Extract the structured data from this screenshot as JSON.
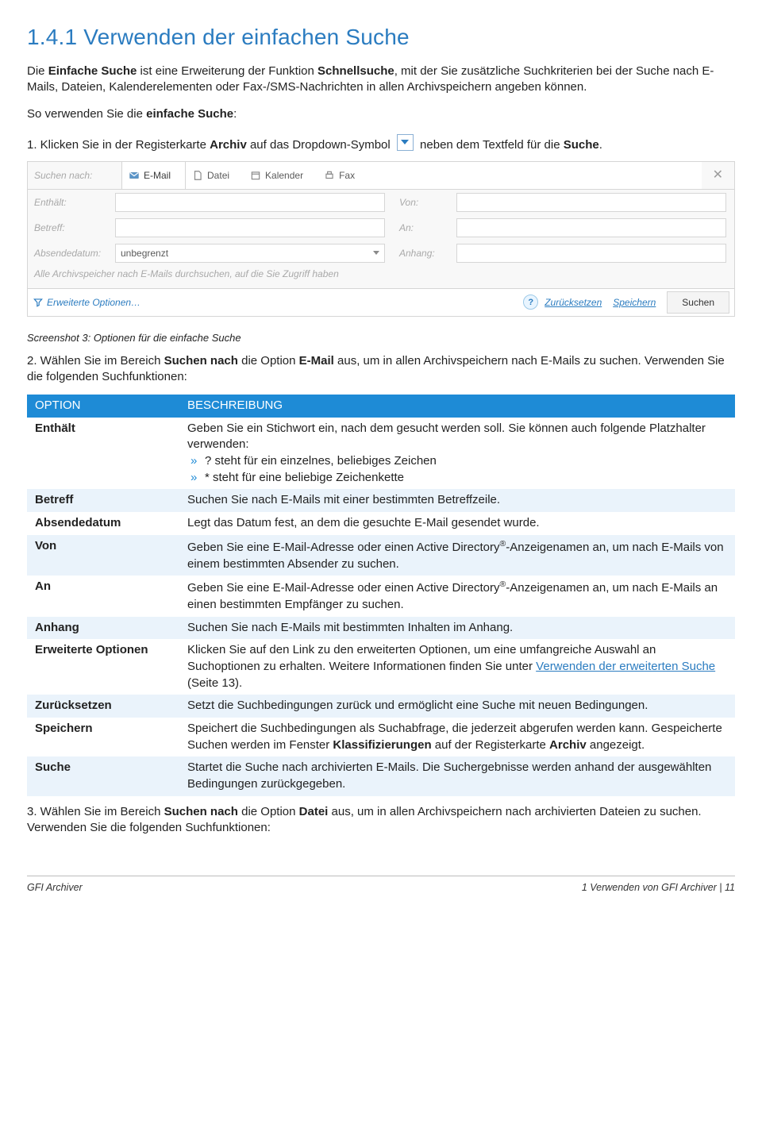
{
  "sectionTitle": "1.4.1 Verwenden der einfachen Suche",
  "intro": {
    "p1_a": "Die ",
    "p1_b": "Einfache Suche",
    "p1_c": " ist eine Erweiterung der Funktion ",
    "p1_d": "Schnellsuche",
    "p1_e": ", mit der Sie zusätzliche Suchkriterien bei der Suche nach E-Mails, Dateien, Kalenderelementen oder Fax-/SMS-Nachrichten in allen Archivspeichern angeben können.",
    "p2_a": "So verwenden Sie die ",
    "p2_b": "einfache Suche",
    "p2_c": ":"
  },
  "step1": {
    "a": "1. Klicken Sie in der Registerkarte ",
    "b": "Archiv",
    "c": " auf das Dropdown-Symbol ",
    "d": " neben dem Textfeld für die ",
    "e": "Suche",
    "f": "."
  },
  "ui": {
    "searchFor": "Suchen nach:",
    "tabs": {
      "email": "E-Mail",
      "file": "Datei",
      "calendar": "Kalender",
      "fax": "Fax"
    },
    "fields": {
      "containsLabel": "Enthält:",
      "fromLabel": "Von:",
      "subjectLabel": "Betreff:",
      "toLabel": "An:",
      "sentDateLabel": "Absendedatum:",
      "sentDateValue": "unbegrenzt",
      "attachmentLabel": "Anhang:"
    },
    "note": "Alle Archivspeicher nach E-Mails durchsuchen, auf die Sie Zugriff haben",
    "advanced": "Erweiterte Optionen…",
    "reset": "Zurücksetzen",
    "save": "Speichern",
    "searchBtn": "Suchen"
  },
  "caption": "Screenshot 3: Optionen für die einfache Suche",
  "step2": {
    "a": "2. Wählen Sie im Bereich ",
    "b": "Suchen nach",
    "c": " die Option ",
    "d": "E-Mail",
    "e": " aus, um in allen Archivspeichern nach E-Mails zu suchen. Verwenden Sie die folgenden Suchfunktionen:"
  },
  "table": {
    "headers": {
      "option": "OPTION",
      "desc": "BESCHREIBUNG"
    },
    "rows": [
      {
        "opt": "Enthält",
        "desc_a": "Geben Sie ein Stichwort ein, nach dem gesucht werden soll. Sie können auch folgende Platzhalter verwenden:",
        "sub1": "? steht für ein einzelnes, beliebiges Zeichen",
        "sub2": "* steht für eine beliebige Zeichenkette"
      },
      {
        "opt": "Betreff",
        "desc": "Suchen Sie nach E-Mails mit einer bestimmten Betreffzeile."
      },
      {
        "opt": "Absendedatum",
        "desc": "Legt das Datum fest, an dem die gesuchte E-Mail gesendet wurde."
      },
      {
        "opt": "Von",
        "desc_a": "Geben Sie eine E-Mail-Adresse oder einen Active Directory",
        "desc_b": "-Anzeigenamen an, um nach E-Mails von einem bestimmten Absender zu suchen."
      },
      {
        "opt": "An",
        "desc_a": "Geben Sie eine E-Mail-Adresse oder einen Active Directory",
        "desc_b": "-Anzeigenamen an, um nach E-Mails an einen bestimmten Empfänger zu suchen."
      },
      {
        "opt": "Anhang",
        "desc": "Suchen Sie nach E-Mails mit bestimmten Inhalten im Anhang."
      },
      {
        "opt": "Erweiterte Optionen",
        "desc_a": "Klicken Sie auf den Link zu den erweiterten Optionen, um eine umfangreiche Auswahl an Suchoptionen zu erhalten. Weitere Informationen finden Sie unter ",
        "link": "Verwenden der erweiterten Suche",
        "desc_b": " (Seite 13)."
      },
      {
        "opt": "Zurücksetzen",
        "desc": "Setzt die Suchbedingungen zurück und ermöglicht eine Suche mit neuen Bedingungen."
      },
      {
        "opt": "Speichern",
        "desc_a": "Speichert die Suchbedingungen als Suchabfrage, die jederzeit abgerufen werden kann. Gespeicherte Suchen werden im Fenster ",
        "desc_b": "Klassifizierungen",
        "desc_c": " auf der Registerkarte ",
        "desc_d": "Archiv",
        "desc_e": " angezeigt."
      },
      {
        "opt": "Suche",
        "desc": "Startet die Suche nach archivierten E-Mails. Die Suchergebnisse werden anhand der ausgewählten Bedingungen zurückgegeben."
      }
    ]
  },
  "step3": {
    "a": "3. Wählen Sie im Bereich ",
    "b": "Suchen nach",
    "c": " die Option ",
    "d": "Datei",
    "e": " aus, um in allen Archivspeichern nach archivierten Dateien zu suchen. Verwenden Sie die folgenden Suchfunktionen:"
  },
  "footer": {
    "left": "GFI Archiver",
    "right_a": "1 Verwenden von GFI Archiver",
    "right_b": " | ",
    "right_c": "11"
  }
}
